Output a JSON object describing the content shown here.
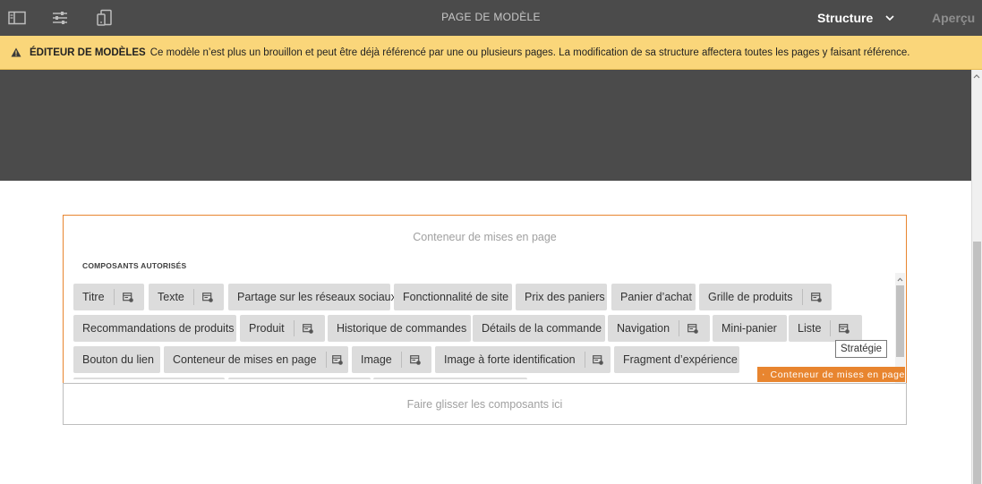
{
  "topbar": {
    "title": "PAGE DE MODÈLE",
    "mode_label": "Structure",
    "preview_label": "Aperçu"
  },
  "alert": {
    "title": "ÉDITEUR DE MODÈLES",
    "message": "Ce modèle n’est plus un brouillon et peut être déjà référencé par une ou plusieurs pages. La modification de sa structure affectera toutes les pages y faisant référence."
  },
  "container": {
    "title": "Conteneur de mises en page",
    "allowed_label": "COMPOSANTS AUTORISÉS",
    "components": [
      {
        "label": "Titre",
        "policy": true
      },
      {
        "label": "Texte",
        "policy": true
      },
      {
        "label": "Partage sur les réseaux sociaux",
        "policy": false
      },
      {
        "label": "Fonctionnalité de site",
        "policy": false
      },
      {
        "label": "Prix des paniers",
        "policy": false
      },
      {
        "label": "Panier d’achat",
        "policy": false
      },
      {
        "label": "Grille de produits",
        "policy": true
      },
      {
        "label": "Recommandations de produits",
        "policy": false
      },
      {
        "label": "Produit",
        "policy": true
      },
      {
        "label": "Historique de commandes",
        "policy": false
      },
      {
        "label": "Détails de la commande",
        "policy": false
      },
      {
        "label": "Navigation",
        "policy": true
      },
      {
        "label": "Mini-panier",
        "policy": false
      },
      {
        "label": "Liste",
        "policy": true
      },
      {
        "label": "Bouton du lien",
        "policy": false
      },
      {
        "label": "Conteneur de mises en page",
        "policy": true
      },
      {
        "label": "Image",
        "policy": true
      },
      {
        "label": "Image à forte identification",
        "policy": true
      },
      {
        "label": "Fragment d’expérience",
        "policy": false
      }
    ],
    "tooltip": "Stratégie",
    "badge_label": "Conteneur de mises en page"
  },
  "drop_zone": {
    "label": "Faire glisser les composants ici"
  },
  "colors": {
    "topbar": "#4b4b4b",
    "alert": "#fad67a",
    "accent": "#e8852f",
    "component": "#dcdcdc"
  }
}
